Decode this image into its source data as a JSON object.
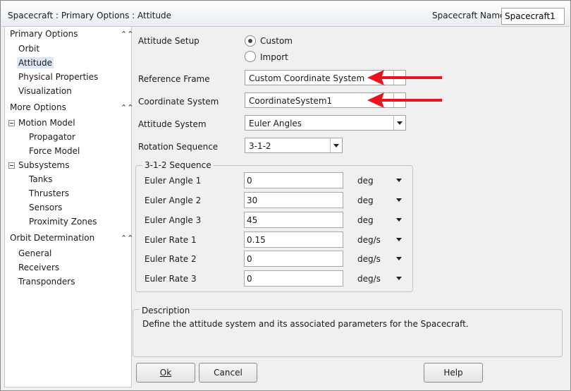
{
  "titlebar": {
    "title": "Spacecraft : Primary Options : Attitude",
    "spacecraft_name_label": "Spacecraft Name",
    "spacecraft_name_value": "Spacecraft1"
  },
  "nav": {
    "primary_options": "Primary Options",
    "orbit": "Orbit",
    "attitude": "Attitude",
    "physical_properties": "Physical Properties",
    "visualization": "Visualization",
    "more_options": "More Options",
    "motion_model": "Motion Model",
    "propagator": "Propagator",
    "force_model": "Force Model",
    "subsystems": "Subsystems",
    "tanks": "Tanks",
    "thrusters": "Thrusters",
    "sensors": "Sensors",
    "proximity_zones": "Proximity Zones",
    "orbit_determination": "Orbit Determination",
    "general": "General",
    "receivers": "Receivers",
    "transponders": "Transponders",
    "collapse_glyph": "⌃⌃"
  },
  "attitude": {
    "setup_label": "Attitude Setup",
    "custom_label": "Custom",
    "import_label": "Import",
    "reference_frame_label": "Reference Frame",
    "reference_frame_value": "Custom Coordinate System",
    "coordinate_system_label": "Coordinate System",
    "coordinate_system_value": "CoordinateSystem1",
    "attitude_system_label": "Attitude System",
    "attitude_system_value": "Euler Angles",
    "rotation_sequence_label": "Rotation Sequence",
    "rotation_sequence_value": "3-1-2"
  },
  "sequence": {
    "title": "3-1-2 Sequence",
    "rows": [
      {
        "label": "Euler Angle 1",
        "value": "0",
        "unit": "deg"
      },
      {
        "label": "Euler Angle 2",
        "value": "30",
        "unit": "deg"
      },
      {
        "label": "Euler Angle 3",
        "value": "45",
        "unit": "deg"
      },
      {
        "label": "Euler Rate 1",
        "value": "0.15",
        "unit": "deg/s"
      },
      {
        "label": "Euler Rate 2",
        "value": "0",
        "unit": "deg/s"
      },
      {
        "label": "Euler Rate 3",
        "value": "0",
        "unit": "deg/s"
      }
    ]
  },
  "description": {
    "title": "Description",
    "text": "Define the attitude system and its associated parameters for the Spacecraft."
  },
  "buttons": {
    "ok": "Ok",
    "cancel": "Cancel",
    "help": "Help"
  },
  "colors": {
    "annotation_arrow": "#e8141a",
    "selected_nav": "#dce8f7"
  }
}
